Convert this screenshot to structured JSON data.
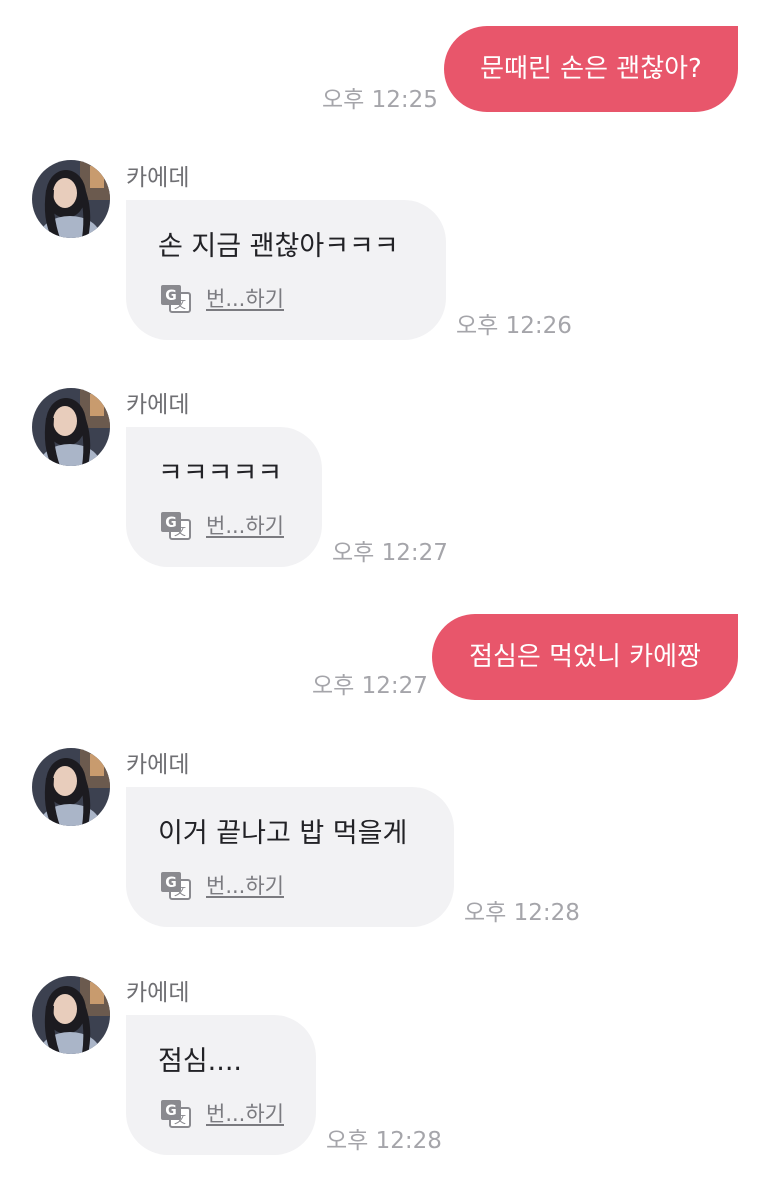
{
  "colors": {
    "outgoing_bubble": "#e8566b",
    "incoming_bubble": "#f2f2f4",
    "timestamp": "#a5a5aa"
  },
  "messages": [
    {
      "direction": "outgoing",
      "text": "문때린 손은 괜찮아?",
      "time": "오후 12:25"
    },
    {
      "direction": "incoming",
      "sender": "카에데",
      "text": "손 지금 괜찮아ㅋㅋㅋ",
      "translate": "번...하기",
      "time": "오후 12:26",
      "avatar_icon": "profile-photo"
    },
    {
      "direction": "incoming",
      "sender": "카에데",
      "text": "ㅋㅋㅋㅋㅋ",
      "translate": "번...하기",
      "time": "오후 12:27",
      "avatar_icon": "profile-photo"
    },
    {
      "direction": "outgoing",
      "text": "점심은 먹었니 카에짱",
      "time": "오후 12:27"
    },
    {
      "direction": "incoming",
      "sender": "카에데",
      "text": "이거 끝나고 밥 먹을게",
      "translate": "번...하기",
      "time": "오후 12:28",
      "avatar_icon": "profile-photo"
    },
    {
      "direction": "incoming",
      "sender": "카에데",
      "text": "점심....",
      "translate": "번...하기",
      "time": "오후 12:28",
      "avatar_icon": "profile-photo"
    }
  ],
  "icons": {
    "translate": "translate-icon"
  }
}
